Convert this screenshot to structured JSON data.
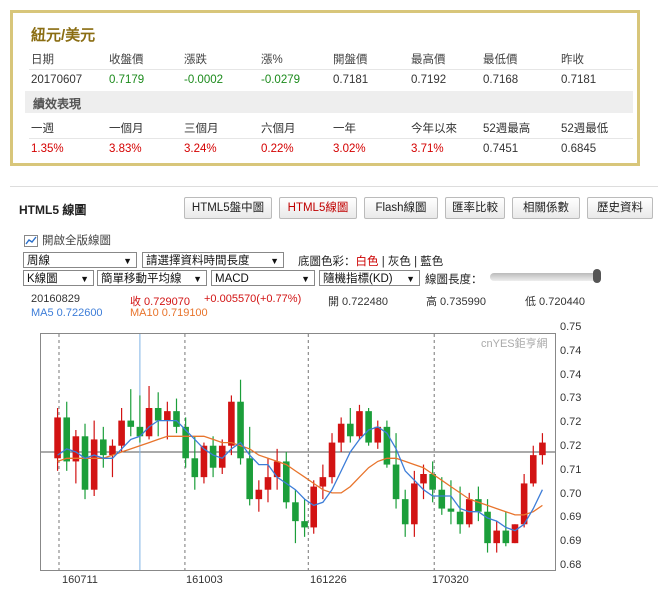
{
  "quote": {
    "pair": "紐元/美元",
    "headers": [
      "日期",
      "收盤價",
      "漲跌",
      "漲%",
      "開盤價",
      "最高價",
      "最低價",
      "昨收"
    ],
    "values": [
      "20170607",
      "0.7179",
      "-0.0002",
      "-0.0279",
      "0.7181",
      "0.7192",
      "0.7168",
      "0.7181"
    ],
    "perf_title": "績效表現",
    "perf_headers": [
      "一週",
      "一個月",
      "三個月",
      "六個月",
      "一年",
      "今年以來",
      "52週最高",
      "52週最低"
    ],
    "perf_values": [
      "1.35%",
      "3.83%",
      "3.24%",
      "0.22%",
      "3.02%",
      "3.71%",
      "0.7451",
      "0.6845"
    ]
  },
  "chart_panel": {
    "title": "HTML5 線圖",
    "tabs": [
      "HTML5盤中圖",
      "HTML5線圖",
      "Flash線圖",
      "匯率比較",
      "相關係數",
      "歷史資料"
    ],
    "active_tab": "HTML5線圖",
    "full_chart_btn": "開啟全版線圖",
    "period_select": "周線",
    "range_select": "請選擇資料時間長度",
    "bg_color_label": "底圖色彩：",
    "bg_color_options": [
      "白色",
      "灰色",
      "藍色"
    ],
    "chart_type_select": "K線圖",
    "ma_select": "簡單移動平均線",
    "indicator_select": "MACD",
    "stoch_select": "隨機指標(KD)",
    "length_label": "線圖長度：",
    "info": {
      "date": "20160829",
      "close": "收 0.729070",
      "change": "+0.005570(+0.77%)",
      "open": "開 0.722480",
      "high": "高 0.735990",
      "low": "低 0.720440",
      "ma5": "MA5 0.722600",
      "ma10": "MA10 0.719100"
    },
    "watermark": "cnYES鉅亨網",
    "colors": {
      "up": "#d21313",
      "down": "#1b9e3a",
      "ma5": "#3d7dd8",
      "ma10": "#e8742c",
      "active_tab": "#c00000",
      "border": "#d8c67a"
    }
  },
  "chart_data": {
    "type": "candlestick",
    "ylim": [
      0.68,
      0.75
    ],
    "yticks": [
      "0.75",
      "0.74",
      "0.74",
      "0.73",
      "0.72",
      "0.72",
      "0.71",
      "0.70",
      "0.69",
      "0.69",
      "0.68"
    ],
    "xticks": [
      "160711",
      "161003",
      "161226",
      "170320"
    ],
    "candles": [
      {
        "o": 0.713,
        "h": 0.729,
        "l": 0.709,
        "c": 0.726
      },
      {
        "o": 0.726,
        "h": 0.731,
        "l": 0.709,
        "c": 0.712
      },
      {
        "o": 0.712,
        "h": 0.722,
        "l": 0.705,
        "c": 0.72
      },
      {
        "o": 0.72,
        "h": 0.724,
        "l": 0.7,
        "c": 0.703
      },
      {
        "o": 0.703,
        "h": 0.725,
        "l": 0.701,
        "c": 0.719
      },
      {
        "o": 0.719,
        "h": 0.723,
        "l": 0.71,
        "c": 0.714
      },
      {
        "o": 0.714,
        "h": 0.719,
        "l": 0.707,
        "c": 0.717
      },
      {
        "o": 0.717,
        "h": 0.729,
        "l": 0.715,
        "c": 0.725
      },
      {
        "o": 0.725,
        "h": 0.735,
        "l": 0.72,
        "c": 0.723
      },
      {
        "o": 0.723,
        "h": 0.733,
        "l": 0.718,
        "c": 0.72
      },
      {
        "o": 0.72,
        "h": 0.736,
        "l": 0.719,
        "c": 0.729
      },
      {
        "o": 0.729,
        "h": 0.734,
        "l": 0.72,
        "c": 0.725
      },
      {
        "o": 0.725,
        "h": 0.731,
        "l": 0.719,
        "c": 0.728
      },
      {
        "o": 0.728,
        "h": 0.732,
        "l": 0.721,
        "c": 0.723
      },
      {
        "o": 0.723,
        "h": 0.726,
        "l": 0.71,
        "c": 0.713
      },
      {
        "o": 0.713,
        "h": 0.72,
        "l": 0.703,
        "c": 0.707
      },
      {
        "o": 0.707,
        "h": 0.718,
        "l": 0.705,
        "c": 0.717
      },
      {
        "o": 0.717,
        "h": 0.72,
        "l": 0.707,
        "c": 0.71
      },
      {
        "o": 0.71,
        "h": 0.719,
        "l": 0.708,
        "c": 0.717
      },
      {
        "o": 0.717,
        "h": 0.733,
        "l": 0.714,
        "c": 0.731
      },
      {
        "o": 0.731,
        "h": 0.738,
        "l": 0.711,
        "c": 0.713
      },
      {
        "o": 0.713,
        "h": 0.723,
        "l": 0.698,
        "c": 0.7
      },
      {
        "o": 0.7,
        "h": 0.706,
        "l": 0.696,
        "c": 0.703
      },
      {
        "o": 0.703,
        "h": 0.713,
        "l": 0.699,
        "c": 0.707
      },
      {
        "o": 0.707,
        "h": 0.716,
        "l": 0.703,
        "c": 0.712
      },
      {
        "o": 0.712,
        "h": 0.715,
        "l": 0.697,
        "c": 0.699
      },
      {
        "o": 0.699,
        "h": 0.703,
        "l": 0.686,
        "c": 0.693
      },
      {
        "o": 0.693,
        "h": 0.7,
        "l": 0.688,
        "c": 0.691
      },
      {
        "o": 0.691,
        "h": 0.706,
        "l": 0.689,
        "c": 0.704
      },
      {
        "o": 0.704,
        "h": 0.711,
        "l": 0.7,
        "c": 0.707
      },
      {
        "o": 0.707,
        "h": 0.721,
        "l": 0.705,
        "c": 0.718
      },
      {
        "o": 0.718,
        "h": 0.726,
        "l": 0.715,
        "c": 0.724
      },
      {
        "o": 0.724,
        "h": 0.729,
        "l": 0.718,
        "c": 0.72
      },
      {
        "o": 0.72,
        "h": 0.73,
        "l": 0.719,
        "c": 0.728
      },
      {
        "o": 0.728,
        "h": 0.729,
        "l": 0.717,
        "c": 0.718
      },
      {
        "o": 0.718,
        "h": 0.725,
        "l": 0.716,
        "c": 0.723
      },
      {
        "o": 0.723,
        "h": 0.725,
        "l": 0.71,
        "c": 0.711
      },
      {
        "o": 0.711,
        "h": 0.721,
        "l": 0.697,
        "c": 0.7
      },
      {
        "o": 0.7,
        "h": 0.703,
        "l": 0.688,
        "c": 0.692
      },
      {
        "o": 0.692,
        "h": 0.709,
        "l": 0.688,
        "c": 0.705
      },
      {
        "o": 0.705,
        "h": 0.711,
        "l": 0.7,
        "c": 0.708
      },
      {
        "o": 0.708,
        "h": 0.712,
        "l": 0.699,
        "c": 0.703
      },
      {
        "o": 0.703,
        "h": 0.707,
        "l": 0.695,
        "c": 0.697
      },
      {
        "o": 0.697,
        "h": 0.706,
        "l": 0.692,
        "c": 0.696
      },
      {
        "o": 0.696,
        "h": 0.704,
        "l": 0.689,
        "c": 0.692
      },
      {
        "o": 0.692,
        "h": 0.702,
        "l": 0.691,
        "c": 0.7
      },
      {
        "o": 0.7,
        "h": 0.704,
        "l": 0.693,
        "c": 0.696
      },
      {
        "o": 0.696,
        "h": 0.7,
        "l": 0.683,
        "c": 0.686
      },
      {
        "o": 0.686,
        "h": 0.693,
        "l": 0.683,
        "c": 0.69
      },
      {
        "o": 0.69,
        "h": 0.696,
        "l": 0.685,
        "c": 0.686
      },
      {
        "o": 0.686,
        "h": 0.692,
        "l": 0.686,
        "c": 0.692
      },
      {
        "o": 0.692,
        "h": 0.708,
        "l": 0.691,
        "c": 0.705
      },
      {
        "o": 0.705,
        "h": 0.717,
        "l": 0.704,
        "c": 0.714
      },
      {
        "o": 0.714,
        "h": 0.721,
        "l": 0.711,
        "c": 0.718
      }
    ],
    "ma5": [
      0.714,
      0.716,
      0.715,
      0.713,
      0.714,
      0.713,
      0.713,
      0.716,
      0.719,
      0.72,
      0.723,
      0.725,
      0.725,
      0.725,
      0.722,
      0.719,
      0.716,
      0.714,
      0.713,
      0.716,
      0.718,
      0.714,
      0.711,
      0.711,
      0.707,
      0.705,
      0.703,
      0.7,
      0.698,
      0.699,
      0.703,
      0.709,
      0.715,
      0.719,
      0.722,
      0.723,
      0.721,
      0.716,
      0.709,
      0.706,
      0.703,
      0.701,
      0.701,
      0.701,
      0.697,
      0.696,
      0.696,
      0.694,
      0.693,
      0.691,
      0.69,
      0.692,
      0.697,
      0.703
    ],
    "ma10": [
      0.712,
      0.713,
      0.713,
      0.713,
      0.713,
      0.713,
      0.714,
      0.715,
      0.716,
      0.717,
      0.718,
      0.719,
      0.72,
      0.72,
      0.72,
      0.72,
      0.72,
      0.719,
      0.718,
      0.718,
      0.717,
      0.716,
      0.714,
      0.713,
      0.712,
      0.711,
      0.709,
      0.707,
      0.705,
      0.703,
      0.702,
      0.702,
      0.704,
      0.707,
      0.71,
      0.712,
      0.713,
      0.713,
      0.712,
      0.711,
      0.71,
      0.708,
      0.706,
      0.704,
      0.702,
      0.7,
      0.699,
      0.698,
      0.697,
      0.696,
      0.695,
      0.695,
      0.696,
      0.698
    ]
  }
}
